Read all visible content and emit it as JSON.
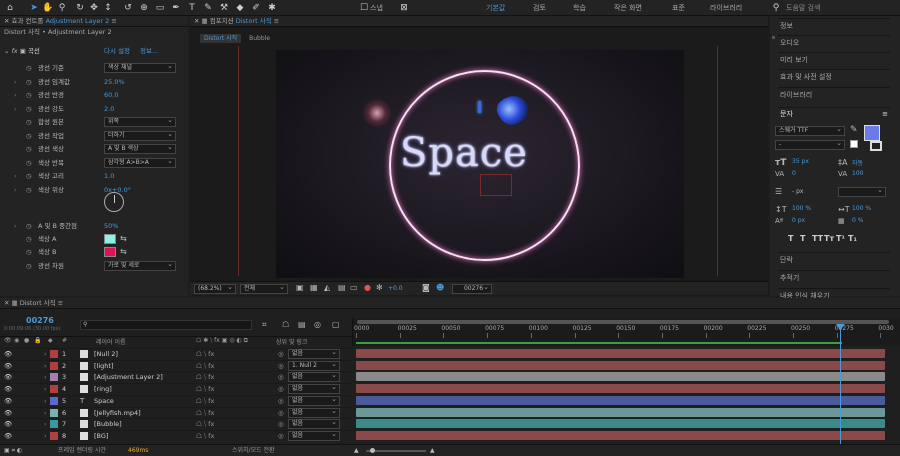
{
  "toolbar": {
    "workspaces": [
      "기본값",
      "검토",
      "학습",
      "작은 화면",
      "표준",
      "라이브러리"
    ],
    "snap_label": "스냅",
    "search_placeholder": "도움말 검색"
  },
  "effects_panel": {
    "tab": "효과 컨트롤",
    "tab_target": "Adjustment Layer 2",
    "breadcrumb": "Distort 사직 • Adjustment Layer 2",
    "fx_name": "곡선",
    "fx_link": "다시 설정",
    "fx_link2": "정보...",
    "props": [
      {
        "label": "광선 기준",
        "value": "색상 채널",
        "kind": "dropdown"
      },
      {
        "label": "광선 임계값",
        "value": "25.0%",
        "kind": "value"
      },
      {
        "label": "광선 반경",
        "value": "60.0",
        "kind": "value"
      },
      {
        "label": "광선 강도",
        "value": "2.0",
        "kind": "value"
      },
      {
        "label": "합성 원본",
        "value": "위쪽",
        "kind": "dropdown"
      },
      {
        "label": "광선 작업",
        "value": "더하기",
        "kind": "dropdown"
      },
      {
        "label": "광선 색상",
        "value": "A 및 B 색상",
        "kind": "dropdown"
      },
      {
        "label": "색상 반복",
        "value": "삼각형 A>B>A",
        "kind": "dropdown"
      },
      {
        "label": "색상 고리",
        "value": "1.0",
        "kind": "value"
      },
      {
        "label": "색상 위상",
        "value": "0x+0.0°",
        "kind": "value"
      },
      {
        "label": "A 및 B 중간점",
        "value": "50%",
        "kind": "value"
      },
      {
        "label": "색상 A",
        "value": "",
        "kind": "swatch",
        "color": "#8ff0e8"
      },
      {
        "label": "색상 B",
        "value": "",
        "kind": "swatch",
        "color": "#e0105a"
      },
      {
        "label": "광선 차원",
        "value": "가로 및 세로",
        "kind": "dropdown"
      }
    ]
  },
  "composition": {
    "tab": "컴포지션",
    "tab_name": "Distort 사직",
    "subtabs": [
      "Distort 사직",
      "Bubble"
    ],
    "title_text": "Space",
    "zoom": "(68.2%)",
    "quality": "전체",
    "exposure": "+0.0",
    "timecode": "00276"
  },
  "right_panel": {
    "items": [
      "정보",
      "오디오",
      "미리 보기",
      "효과 및 사전 설정",
      "라이브러리"
    ],
    "character": {
      "title": "문자",
      "font": "스웨거 TTF",
      "style": "-",
      "size": "35 px",
      "leading": "자동",
      "kerning": "0",
      "tracking": "100",
      "stroke": "- px",
      "vscale": "100 %",
      "hscale": "100 %",
      "baseline": "0 px",
      "tsume": "0 %",
      "styles": [
        "T",
        "T",
        "TT",
        "Tт",
        "T¹",
        "T₁"
      ]
    },
    "bottom_items": [
      "단락",
      "추적기",
      "내용 인식 채우기"
    ]
  },
  "timeline": {
    "tab": "Distort 사직",
    "timecode": "00276",
    "timecode_sub": "0:00:09:06 (30.00 fps)",
    "search_placeholder": "",
    "col_headers": {
      "index": "#",
      "name": "레이어 이름",
      "parent": "상위 및 링크"
    },
    "ruler": [
      "0000",
      "00025",
      "00050",
      "00075",
      "00100",
      "00125",
      "00150",
      "00175",
      "00200",
      "00225",
      "00250",
      "00275",
      "0030"
    ],
    "playhead_frame": 276,
    "layers": [
      {
        "num": "1",
        "name": "[Null 2]",
        "color": "#b04040",
        "parent": "없음",
        "bar": "#8a4a4a"
      },
      {
        "num": "2",
        "name": "[light]",
        "color": "#b04040",
        "parent": "1. Null 2",
        "bar": "#8a4a4a"
      },
      {
        "num": "3",
        "name": "[Adjustment Layer 2]",
        "color": "#a080b0",
        "parent": "없음",
        "bar": "#8a8a8a"
      },
      {
        "num": "4",
        "name": "[ring]",
        "color": "#b04040",
        "parent": "없음",
        "bar": "#8a4a4a"
      },
      {
        "num": "5",
        "name": "Space",
        "color": "#5a6ad0",
        "parent": "없음",
        "bar": "#4a5a9a"
      },
      {
        "num": "6",
        "name": "[Jellyfish.mp4]",
        "color": "#7ab0b0",
        "parent": "없음",
        "bar": "#6a9898"
      },
      {
        "num": "7",
        "name": "[Bubble]",
        "color": "#3a9a9a",
        "parent": "없음",
        "bar": "#3a8a8a"
      },
      {
        "num": "8",
        "name": "[BG]",
        "color": "#b04040",
        "parent": "없음",
        "bar": "#8a4a4a"
      }
    ],
    "footer": {
      "render_label": "프레임 렌더링 시간",
      "render_value": "469ms",
      "toggle": "스위치/모드 전환"
    }
  },
  "colors": {
    "accent": "#4a9ad8",
    "work_area": "#3aa040",
    "playhead": "#4a9ad8"
  }
}
